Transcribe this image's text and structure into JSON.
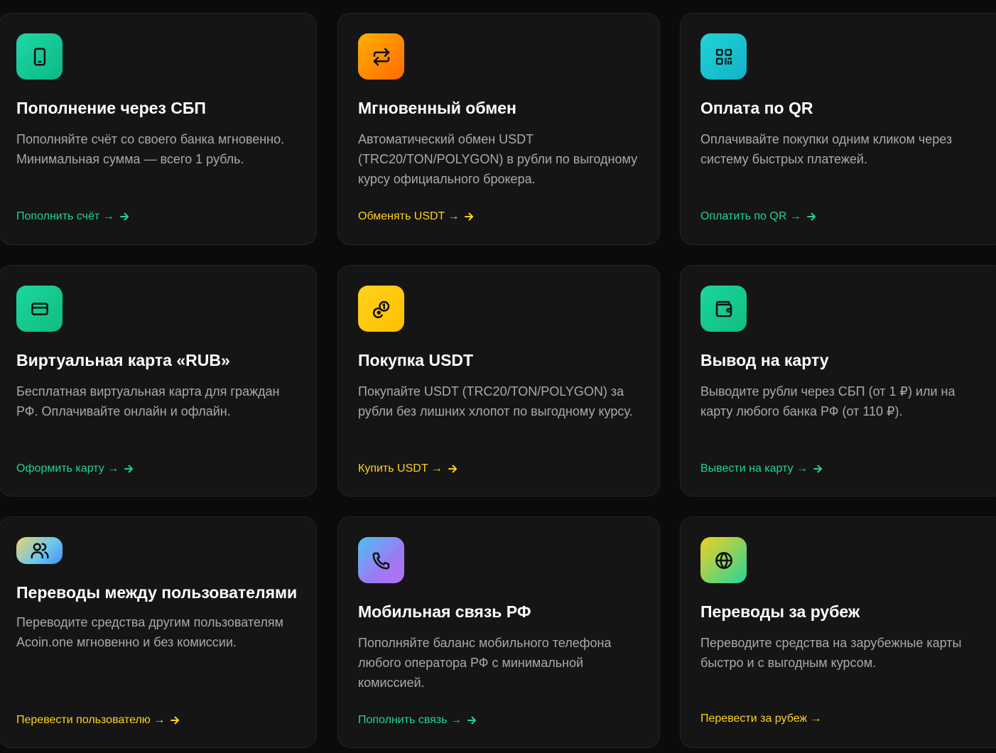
{
  "cards": [
    {
      "icon": "phone-device-icon",
      "title": "Пополнение через СБП",
      "desc": "Пополняйте счёт со своего банка мгновенно. Минимальная сумма — всего 1 рубль.",
      "link": "Пополнить счёт →",
      "link_color": "#1fd39a"
    },
    {
      "icon": "exchange-arrows-icon",
      "title": "Мгновенный обмен",
      "desc": "Автоматический обмен USDT (TRC20/TON/POLYGON) в рубли по выгодному курсу официального брокера.",
      "link": "Обменять USDT →",
      "link_color": "#ffd21c"
    },
    {
      "icon": "qr-code-icon",
      "title": "Оплата по QR",
      "desc": "Оплачивайте покупки одним кликом через систему быстрых платежей.",
      "link": "Оплатить по QR →",
      "link_color": "#1fd39a"
    },
    {
      "icon": "credit-card-icon",
      "title": "Виртуальная карта «RUB»",
      "desc": "Бесплатная виртуальная карта для граждан РФ. Оплачивайте онлайн и офлайн.",
      "link": "Оформить карту →",
      "link_color": "#1fd39a"
    },
    {
      "icon": "coins-icon",
      "title": "Покупка USDT",
      "desc": "Покупайте USDT (TRC20/TON/POLYGON) за рубли без лишних хлопот по выгодному курсу.",
      "link": "Купить USDT →",
      "link_color": "#ffd21c"
    },
    {
      "icon": "wallet-icon",
      "title": "Вывод на карту",
      "desc": "Выводите рубли через СБП (от 1 ₽) или на карту любого банка РФ (от 110 ₽).",
      "link": "Вывести на карту →",
      "link_color": "#1fd39a"
    },
    {
      "icon": "users-icon",
      "title": "Переводы между пользователями",
      "desc": "Переводите средства другим пользователям Acoin.one мгновенно и без комиссии.",
      "link": "Перевести пользователю →",
      "link_color": "#ffd21c"
    },
    {
      "icon": "phone-call-icon",
      "title": "Мобильная связь РФ",
      "desc": "Пополняйте баланс мобильного телефона любого оператора РФ с минимальной комиссией.",
      "link": "Пополнить связь →",
      "link_color": "#1fd39a"
    },
    {
      "icon": "globe-icon",
      "title": "Переводы за рубеж",
      "desc": "Переводите средства на зарубежные карты быстро и с выгодным курсом.",
      "link": "Перевести за рубеж →",
      "link_color": "#ffd21c"
    }
  ]
}
